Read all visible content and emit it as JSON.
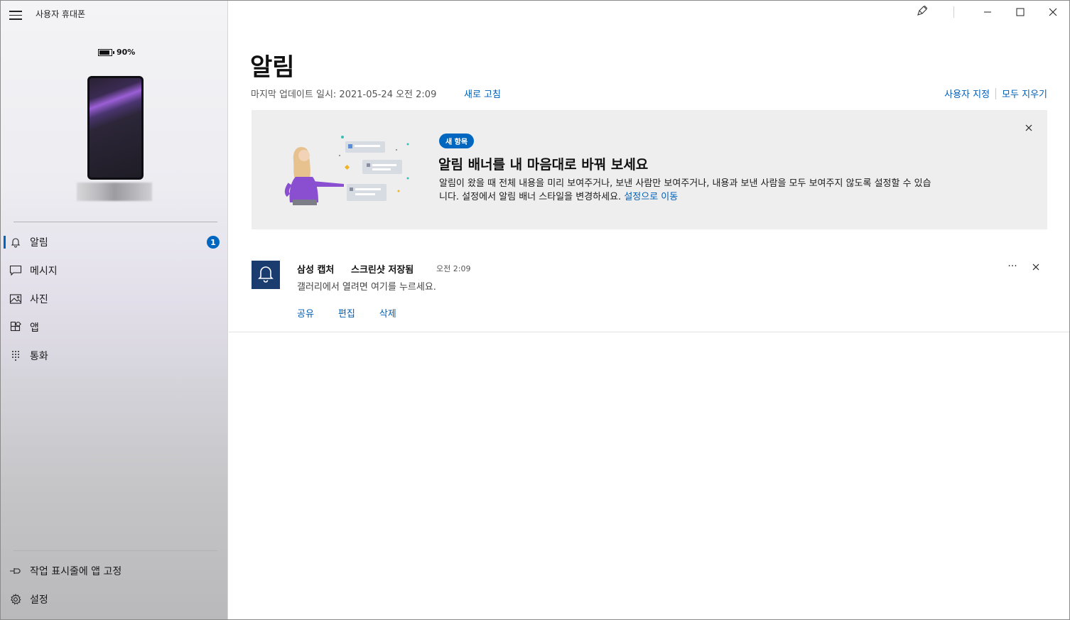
{
  "app": {
    "title": "사용자 휴대폰"
  },
  "phone": {
    "battery_text": "90%",
    "battery_level": 0.9
  },
  "nav": {
    "items": [
      {
        "label": "알림",
        "icon": "bell-icon",
        "badge": "1",
        "active": true
      },
      {
        "label": "메시지",
        "icon": "message-icon"
      },
      {
        "label": "사진",
        "icon": "photo-icon"
      },
      {
        "label": "앱",
        "icon": "apps-icon"
      },
      {
        "label": "통화",
        "icon": "dialpad-icon"
      }
    ],
    "bottom": [
      {
        "label": "작업 표시줄에 앱 고정",
        "icon": "pin-icon"
      },
      {
        "label": "설정",
        "icon": "gear-icon"
      }
    ]
  },
  "window_controls": {
    "icons": [
      "brush-icon",
      "minimize-icon",
      "maximize-icon",
      "close-icon"
    ]
  },
  "main": {
    "title": "알림",
    "last_updated": "마지막 업데이트 일시: 2021-05-24 오전 2:09",
    "refresh": "새로 고침",
    "customize": "사용자 지정",
    "clear_all": "모두 지우기"
  },
  "banner": {
    "badge": "새 항목",
    "title": "알림 배너를 내 마음대로 바꿔 보세요",
    "body_line1": "알림이 왔을 때 전체 내용을 미리 보여주거나, 보낸 사람만 보여주거나, 내용과 보낸 사람을 모두 보여주지 않도록 설정할 수 있습",
    "body_line2": "니다. 설정에서 알림 배너 스타일을 변경하세요. ",
    "link": "설정으로 이동"
  },
  "notification": {
    "app": "삼성 캡처",
    "title": "스크린샷 저장됨",
    "time": "오전 2:09",
    "body": "갤러리에서 열려면 여기를 누르세요.",
    "actions": [
      "공유",
      "편집",
      "삭제"
    ],
    "more": "···"
  },
  "colors": {
    "accent": "#0067c0",
    "link": "#005fb8",
    "notif_icon_bg": "#1a3c6e",
    "banner_bg": "#eeeeee"
  }
}
